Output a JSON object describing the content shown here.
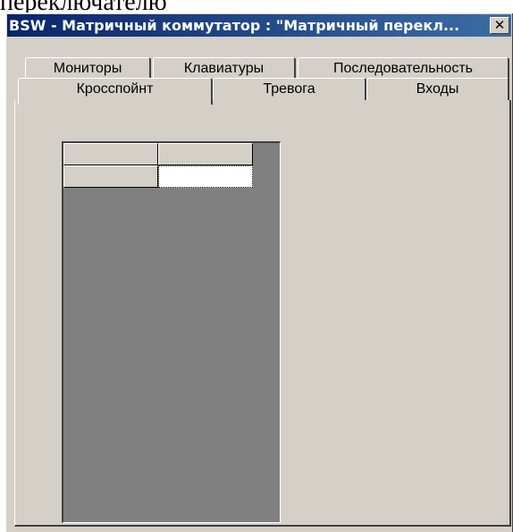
{
  "caption_fragment": "переключателю",
  "window": {
    "title": "BSW - Матричный коммутатор : \"Матричный перекл...",
    "close_glyph": "✕"
  },
  "tabs": {
    "back_row": [
      "Мониторы",
      "Клавиатуры",
      "Последовательность"
    ],
    "front_row": [
      "Кросспойнт",
      "Тревога",
      "Входы"
    ],
    "active": "Кросспойнт"
  },
  "grid": {
    "rows": [
      [
        "",
        ""
      ],
      [
        "",
        ""
      ]
    ]
  },
  "colors": {
    "title_start": "#0a246a",
    "title_end": "#3b6ea5",
    "face": "#d4d0c8",
    "grid_background": "#808080"
  }
}
